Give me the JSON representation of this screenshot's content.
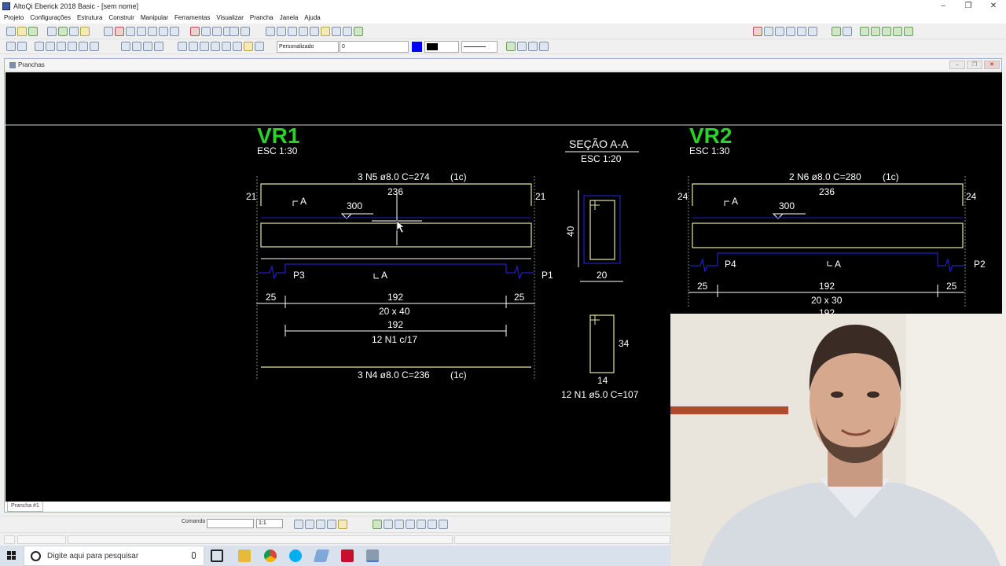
{
  "window": {
    "title": "AltoQi Eberick 2018 Basic - [sem nome]",
    "minimize": "–",
    "restore": "❐",
    "close": "✕"
  },
  "menu": [
    "Projeto",
    "Configurações",
    "Estrutura",
    "Construir",
    "Manipular",
    "Ferramentas",
    "Visualizar",
    "Prancha",
    "Janela",
    "Ajuda"
  ],
  "toolbar": {
    "layer_select": "Personalizado",
    "value_select": "0",
    "color_blue": "#0000ff",
    "color_black": "#000000"
  },
  "document": {
    "title": "Pranchas",
    "sheet_tab": "Prancha #1"
  },
  "drawing": {
    "vr1": {
      "title": "VR1",
      "scale": "ESC 1:30",
      "top_bar": "3 N5 ø8.0 C=274",
      "top_bar_layers": "(1c)",
      "top_len": "236",
      "left_hook": "21",
      "right_hook": "21",
      "section_mark": "A",
      "level": "300",
      "support_left": "P3",
      "support_right": "P1",
      "dim_left": "25",
      "dim_mid": "192",
      "dim_right": "25",
      "section": "20 x 40",
      "stirrup_len": "192",
      "stirrups": "12 N1 c/17",
      "bottom_bar": "3 N4 ø8.0 C=236",
      "bottom_bar_layers": "(1c)"
    },
    "section_aa": {
      "title": "SEÇÃO A-A",
      "scale": "ESC 1:20",
      "height": "40",
      "width": "20",
      "stirrup_height": "34",
      "stirrup_width": "14",
      "stirrup_label": "12 N1 ø5.0 C=107"
    },
    "vr2": {
      "title": "VR2",
      "scale": "ESC 1:30",
      "top_bar": "2 N6 ø8.0 C=280",
      "top_bar_layers": "(1c)",
      "top_len": "236",
      "left_hook": "24",
      "right_hook": "24",
      "section_mark": "A",
      "level": "300",
      "support_left": "P4",
      "support_right": "P2",
      "dim_left": "25",
      "dim_mid": "192",
      "dim_right": "25",
      "section": "20 x 30",
      "stirrup_len": "192"
    }
  },
  "command": {
    "label": "Comando",
    "scale": "1:1"
  },
  "taskbar": {
    "search_placeholder": "Digite aqui para pesquisar"
  }
}
